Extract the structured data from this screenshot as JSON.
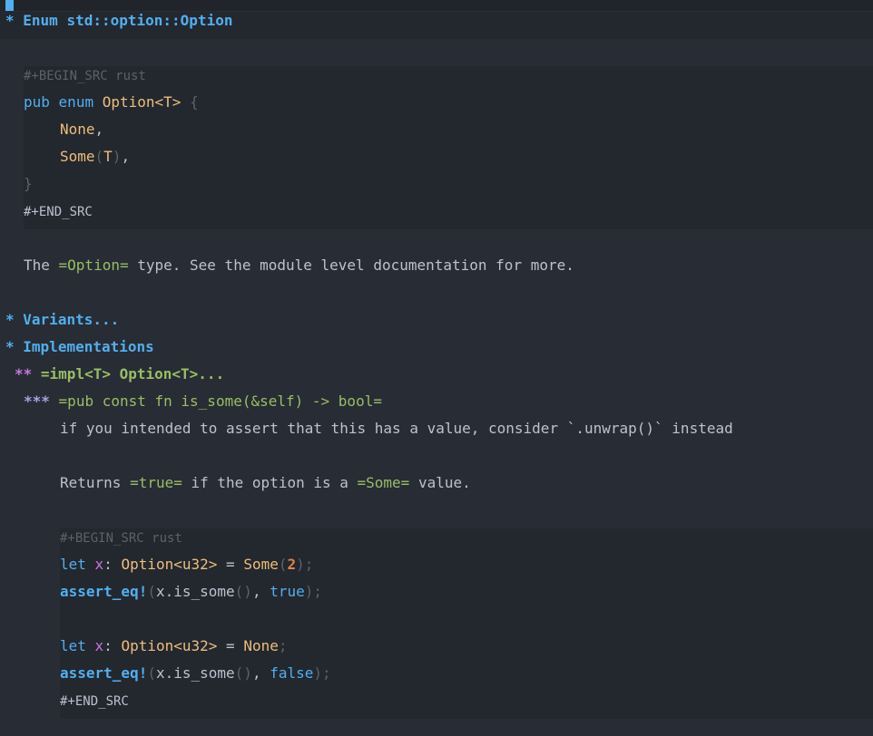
{
  "heading1": {
    "star": "*",
    "title": "Enum std::option::Option"
  },
  "src1": {
    "begin": "#+BEGIN_SRC rust",
    "l1_kw1": "pub",
    "l1_kw2": "enum",
    "l1_type": "Option<T>",
    "l1_brace": "{",
    "l2": "None",
    "l2_punct": ",",
    "l3_name": "Some",
    "l3_open": "(",
    "l3_T": "T",
    "l3_close": ")",
    "l3_punct": ",",
    "l4": "}",
    "end": "#+END_SRC"
  },
  "para1": {
    "pre": "The ",
    "code": "=Option=",
    "post": " type. See the module level documentation for more."
  },
  "heading_variants": {
    "star": "*",
    "title": "Variants..."
  },
  "heading_impls": {
    "star": "*",
    "title": "Implementations"
  },
  "heading2": {
    "stars": "**",
    "title": "=impl<T> Option<T>...",
    "ellipsis": "..."
  },
  "heading3": {
    "stars": "***",
    "title": "=pub const fn is_some(&self) -> bool="
  },
  "para2": {
    "text": "if you intended to assert that this has a value, consider `.unwrap()` instead"
  },
  "para3": {
    "pre": "Returns ",
    "code1": "=true=",
    "mid": " if the option is a ",
    "code2": "=Some=",
    "post": " value."
  },
  "src2": {
    "begin": "#+BEGIN_SRC rust",
    "a1_let": "let",
    "a1_x": "x",
    "a1_colon": ": ",
    "a1_type": "Option<u32>",
    "a1_eq": " = ",
    "a1_some": "Some",
    "a1_open": "(",
    "a1_num": "2",
    "a1_close": ");",
    "a2_macro": "assert_eq!",
    "a2_open": "(",
    "a2_expr": "x.is_some",
    "a2_paren": "()",
    "a2_comma": ", ",
    "a2_val": "true",
    "a2_close": ");",
    "b1_let": "let",
    "b1_x": "x",
    "b1_colon": ": ",
    "b1_type": "Option<u32>",
    "b1_eq": " = ",
    "b1_none": "None",
    "b1_semi": ";",
    "b2_macro": "assert_eq!",
    "b2_open": "(",
    "b2_expr": "x.is_some",
    "b2_paren": "()",
    "b2_comma": ", ",
    "b2_val": "false",
    "b2_close": ");",
    "end": "#+END_SRC"
  },
  "colors": {
    "bg": "#282c34",
    "block_bg": "#23272e",
    "heading": "#51afef",
    "keyword": "#51afef",
    "type": "#ECBE7B",
    "string_green": "#98be65",
    "level2": "#c678dd",
    "level3": "#a9a1e1",
    "number": "#da8548"
  }
}
